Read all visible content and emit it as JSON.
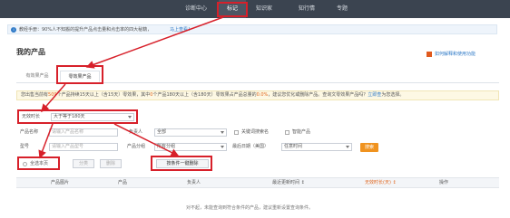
{
  "nav": {
    "tabs": [
      {
        "label": "诊断中心",
        "active": false
      },
      {
        "label": "标记",
        "active": true
      },
      {
        "label": "知识家",
        "active": false
      },
      {
        "label": "知行情",
        "active": false
      },
      {
        "label": "专题",
        "active": false
      }
    ]
  },
  "notice": {
    "text": "教经手册：90%人不知搬的提升产品点击量和点击率的四大秘籍，",
    "link": "马上查看！"
  },
  "page": {
    "title": "我的产品",
    "help_link": "如何解释和使用功能"
  },
  "product_tabs": {
    "tab1": "有效果产品",
    "tab2": "零效果产品"
  },
  "warning": {
    "part1": "您出售当前有",
    "count1": "509",
    "part2": "个产品持续15天以上（含15天）零效果，其中",
    "count2": "0",
    "part3": "个产品180天以上（含180天）零效果占产品总量的",
    "percent": "0.0%",
    "part4": "，建议您优化或删除产品。查询文零效果产品吗？",
    "link": "立即查",
    "part5": "为您选择。"
  },
  "filters": {
    "duration_label": "无效时长",
    "duration_value": "大于等于180天",
    "product_name_label": "产品名称",
    "product_name_placeholder": "请输入产品名称",
    "owner_label": "负责人",
    "owner_value": "全部",
    "keyword_checkbox": "关键词搜索名",
    "smart_product_checkbox": "智能产品",
    "model_label": "型号",
    "model_placeholder": "请输入产品型号",
    "group_label": "产品分组",
    "group_value": "所有分组",
    "update_label": "最后日期（美国）",
    "update_value": "任意时间",
    "search_button": "搜索"
  },
  "actions": {
    "select_all": "全选本页",
    "btn_a": "分类",
    "btn_b": "删除",
    "delete_all": "按条件一键删除"
  },
  "table": {
    "headers": [
      "产品图片",
      "产品",
      "负责人",
      "最近更新时间 ↕",
      "无效时长(天) ↕",
      "操作"
    ],
    "empty_text": "对不起，未能查询到符合条件的产品，建议重新设置查询条件。"
  },
  "colors": {
    "nav_bg": "#3b4450",
    "accent": "#f0931f",
    "annotation": "#d7202a",
    "link": "#2f7ac7"
  }
}
